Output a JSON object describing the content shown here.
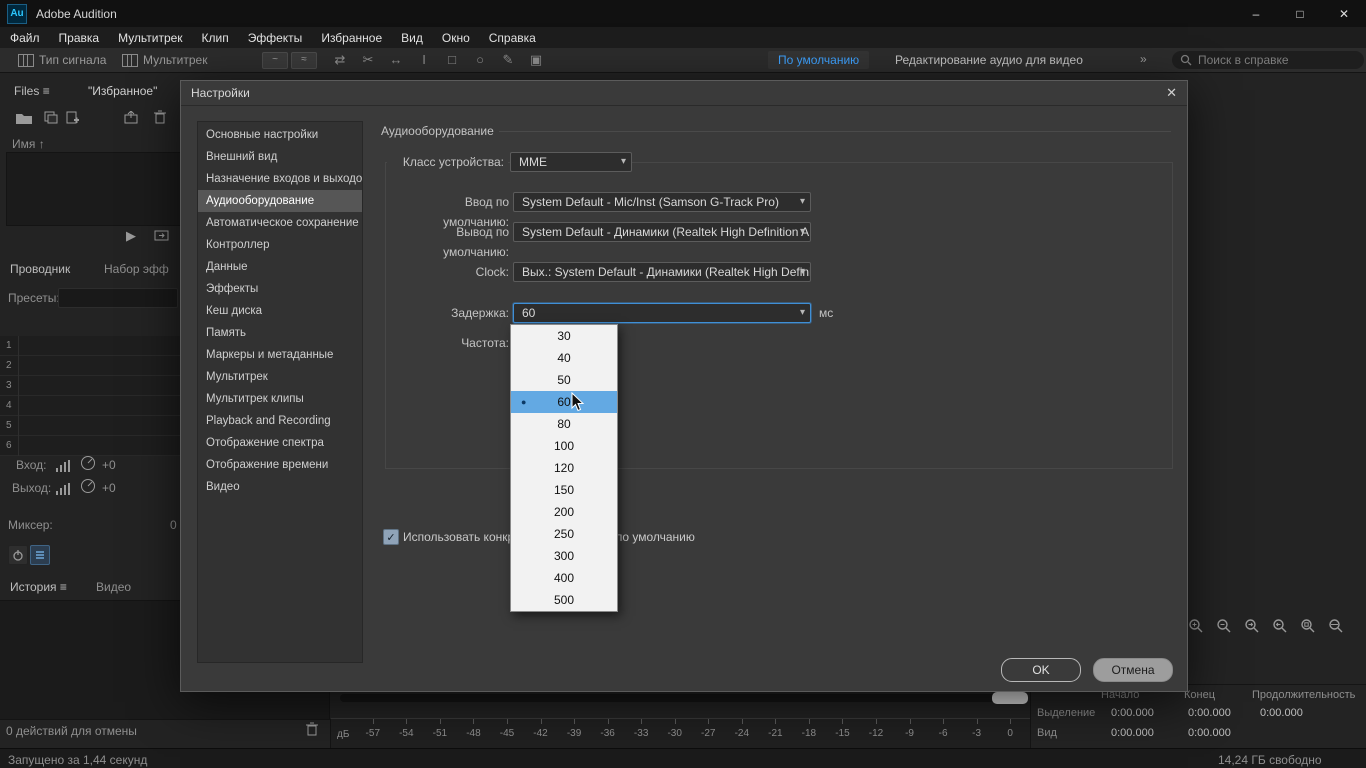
{
  "window": {
    "logo_text": "Au",
    "title": "Adobe Audition",
    "minimize": "–",
    "maximize": "□",
    "close": "✕"
  },
  "menubar": {
    "items": [
      "Файл",
      "Правка",
      "Мультитрек",
      "Клип",
      "Эффекты",
      "Избранное",
      "Вид",
      "Окно",
      "Справка"
    ]
  },
  "toolbar": {
    "waveform_type_label": "Тип сигнала",
    "multitrack_label": "Мультитрек",
    "view_glyph_wave": "~",
    "view_glyph_spectral": "≈",
    "tool_glyphs": [
      "⇄",
      "✂",
      "↔",
      "I",
      "□",
      "○",
      "✎",
      "▣"
    ],
    "workspace_active": "По умолчанию",
    "workspace_secondary": "Редактирование аудио для видео",
    "overflow_glyph": "»",
    "search_placeholder": "Поиск в справке"
  },
  "files_panel": {
    "files_tab": "Files",
    "menu_glyph": "≡",
    "favorites_tab": "\"Избранное\"",
    "name_header": "Имя",
    "sort_glyph": "↑",
    "play_glyph": "▶",
    "explorer_tab": "Проводник",
    "effects_tab": "Набор эфф",
    "presets_label": "Пресеты:",
    "rows": [
      "1",
      "2",
      "3",
      "4",
      "5",
      "6"
    ],
    "input_label": "Вход:",
    "input_gain": "+0",
    "output_label": "Выход:",
    "output_gain": "+0",
    "mixer_label": "Миксер:",
    "mixer_value": "0",
    "history_tab": "История",
    "video_tab": "Видео",
    "undo_status": "0 действий для отмены"
  },
  "dialog": {
    "title": "Настройки",
    "close_glyph": "✕",
    "categories": [
      "Основные настройки",
      "Внешний вид",
      "Назначение входов и выходов",
      "Аудиооборудование",
      "Автоматическое сохранение",
      "Контроллер",
      "Данные",
      "Эффекты",
      "Кеш диска",
      "Память",
      "Маркеры и метаданные",
      "Мультитрек",
      "Мультитрек клипы",
      "Playback and Recording",
      "Отображение спектра",
      "Отображение времени",
      "Видео"
    ],
    "selected_category": "Аудиооборудование",
    "section_title": "Аудиооборудование",
    "chevron_glyph": "▾",
    "fields": {
      "device_class_label": "Класс устройства:",
      "device_class_value": "MME",
      "default_input_label": "Ввод по умолчанию:",
      "default_input_value": "System Default - Mic/Inst (Samson G-Track Pro)",
      "default_output_label": "Вывод по умолчанию:",
      "default_output_value": "System Default - Динамики (Realtek High Definition A...",
      "clock_label": "Clock:",
      "clock_value": "Вых.: System Default - Динамики (Realtek High Definit...",
      "latency_label": "Задержка:",
      "latency_value": "60",
      "latency_unit": "мс",
      "sample_rate_label": "Частота:"
    },
    "checkbox_glyph": "✓",
    "checkbox_label": "Использовать конкретный интерфейс по умолчанию",
    "ok_label": "OK",
    "cancel_label": "Отмена"
  },
  "latency_dropdown": {
    "options": [
      "30",
      "40",
      "50",
      "60",
      "80",
      "100",
      "120",
      "150",
      "200",
      "250",
      "300",
      "400",
      "500"
    ],
    "selected": "60",
    "bullet_glyph": "●"
  },
  "ruler": {
    "unit": "дБ",
    "ticks": [
      "-57",
      "-54",
      "-51",
      "-48",
      "-45",
      "-42",
      "-39",
      "-36",
      "-33",
      "-30",
      "-27",
      "-24",
      "-21",
      "-18",
      "-15",
      "-12",
      "-9",
      "-6",
      "-3",
      "0"
    ]
  },
  "selection_panel": {
    "headers": [
      "Начало",
      "Конец",
      "Продолжительность"
    ],
    "rows": [
      {
        "label": "Выделение",
        "values": [
          "0:00.000",
          "0:00.000",
          "0:00.000"
        ]
      },
      {
        "label": "Вид",
        "values": [
          "0:00.000",
          "0:00.000"
        ]
      }
    ]
  },
  "status_bar": {
    "left": "Запущено за 1,44 секунд",
    "right": "14,24 ГБ свободно"
  }
}
